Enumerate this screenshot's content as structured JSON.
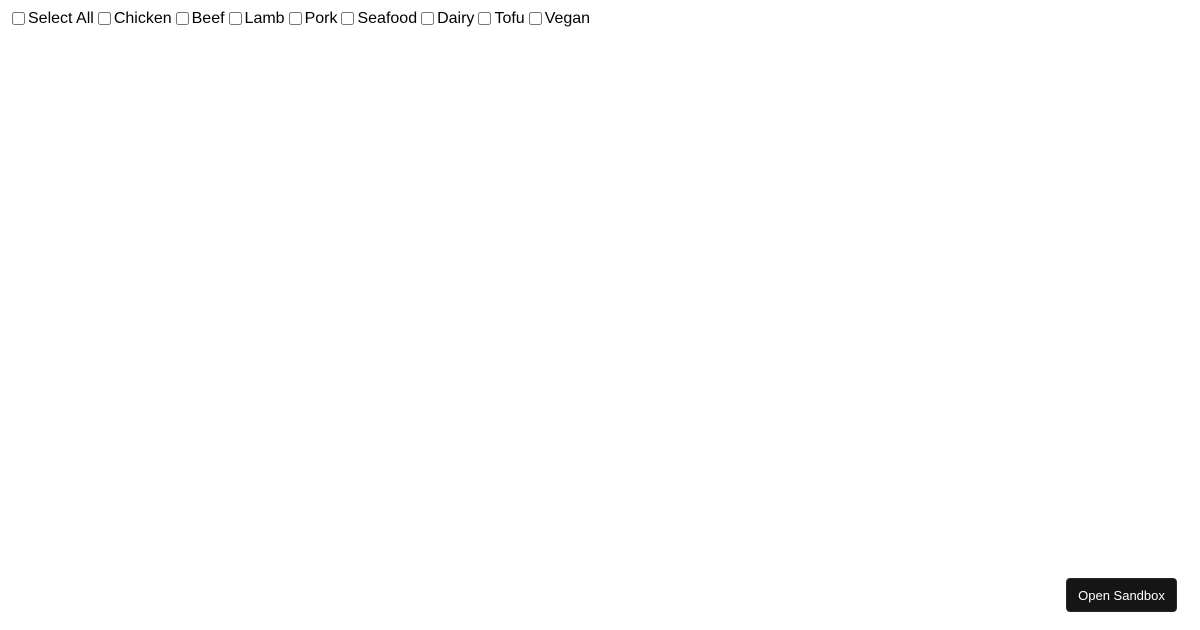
{
  "filters": {
    "options": [
      {
        "label": "Select All",
        "checked": false
      },
      {
        "label": "Chicken",
        "checked": false
      },
      {
        "label": "Beef",
        "checked": false
      },
      {
        "label": "Lamb",
        "checked": false
      },
      {
        "label": "Pork",
        "checked": false
      },
      {
        "label": "Seafood",
        "checked": false
      },
      {
        "label": "Dairy",
        "checked": false
      },
      {
        "label": "Tofu",
        "checked": false
      },
      {
        "label": "Vegan",
        "checked": false
      }
    ]
  },
  "footer": {
    "open_sandbox_label": "Open Sandbox"
  }
}
